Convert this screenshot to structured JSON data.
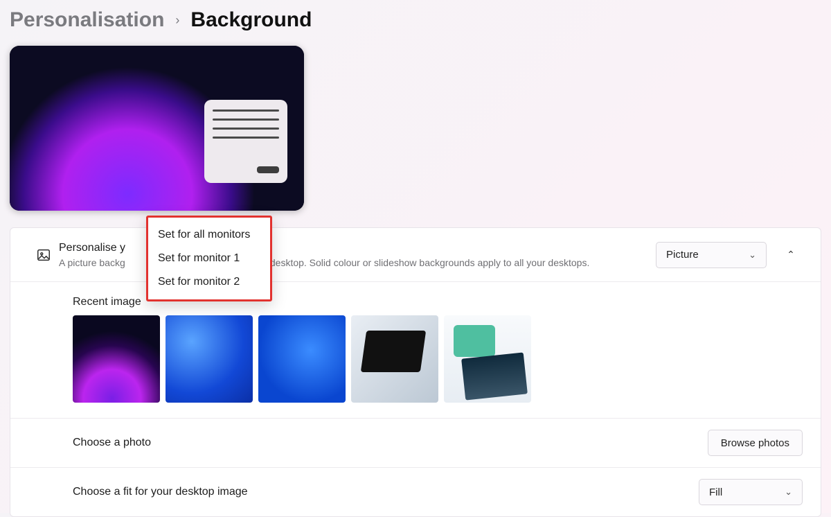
{
  "breadcrumb": {
    "parent": "Personalisation",
    "current": "Background"
  },
  "personalise": {
    "title": "Personalise your background",
    "title_truncated": "Personalise y",
    "subtitle_full": "A picture background applies to your current desktop. Solid colour or slideshow backgrounds apply to all your desktops.",
    "subtitle_left": "A picture backg",
    "subtitle_right": "ent desktop. Solid colour or slideshow backgrounds apply to all your desktops.",
    "dropdown_value": "Picture"
  },
  "context_menu": {
    "items": [
      "Set for all monitors",
      "Set for monitor 1",
      "Set for monitor 2"
    ]
  },
  "recent": {
    "label": "Recent image",
    "thumbs": [
      "bloom-dark",
      "blue-abstract",
      "win11-bloom-light",
      "laptop-hands",
      "laptop-product"
    ]
  },
  "choose_photo": {
    "label": "Choose a photo",
    "button": "Browse photos"
  },
  "choose_fit": {
    "label": "Choose a fit for your desktop image",
    "dropdown_value": "Fill"
  }
}
